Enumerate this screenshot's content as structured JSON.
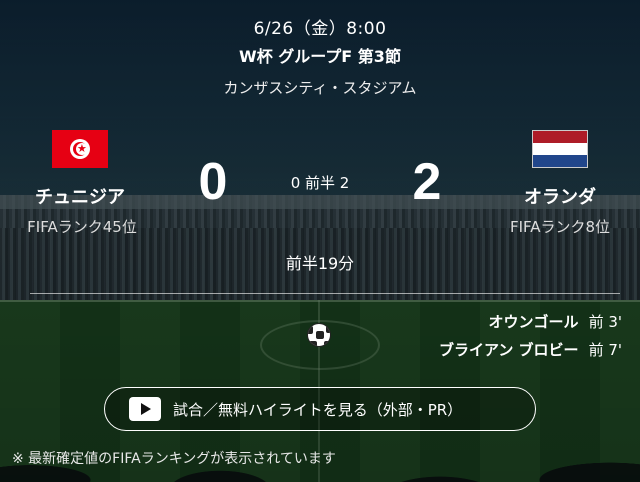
{
  "match": {
    "datetime": "6/26（金）8:00",
    "competition": "W杯 グループF 第3節",
    "venue": "カンザスシティ・スタジアム",
    "half_score": "0 前半 2",
    "time_status": "前半19分"
  },
  "home": {
    "name": "チュニジア",
    "rank": "FIFAランク45位",
    "score": "0",
    "flag": "tunisia-flag-icon"
  },
  "away": {
    "name": "オランダ",
    "rank": "FIFAランク8位",
    "score": "2",
    "flag": "netherlands-flag-icon"
  },
  "goals": [
    {
      "scorer": "オウンゴール",
      "time": "前 3'"
    },
    {
      "scorer": "ブライアン ブロビー",
      "time": "前 7'"
    }
  ],
  "highlight_button": {
    "label": "試合／無料ハイライトを見る（外部・PR）",
    "icon": "play-icon"
  },
  "footnote": "※ 最新確定値のFIFAランキングが表示されています",
  "colors": {
    "tunisia_red": "#e60013",
    "nl_red": "#ae1c28",
    "nl_blue": "#21468b"
  }
}
